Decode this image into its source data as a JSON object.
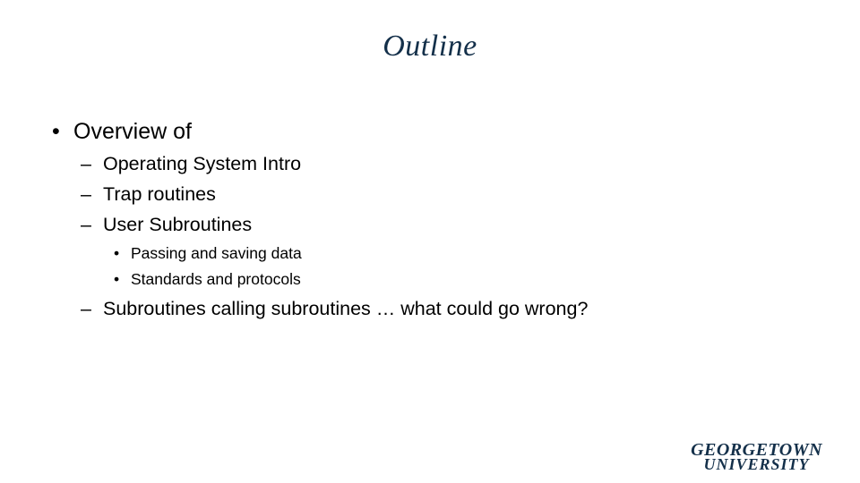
{
  "slide": {
    "title": "Outline",
    "bullets": [
      {
        "marker": "•",
        "text": "Overview of"
      },
      {
        "marker": "–",
        "text": "Operating System Intro"
      },
      {
        "marker": "–",
        "text": "Trap routines"
      },
      {
        "marker": "–",
        "text": "User Subroutines"
      },
      {
        "marker": "•",
        "text": "Passing and saving data"
      },
      {
        "marker": "•",
        "text": "Standards and protocols"
      },
      {
        "marker": "–",
        "text": "Subroutines calling subroutines … what could go wrong?"
      }
    ],
    "logo": {
      "line1": "GEORGETOWN",
      "line2": "UNIVERSITY"
    }
  }
}
